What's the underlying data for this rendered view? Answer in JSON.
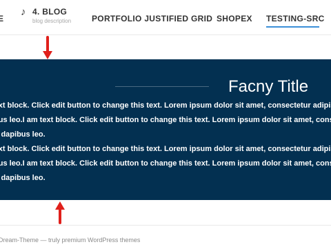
{
  "nav": {
    "cut_item": "E",
    "blog": {
      "icon_glyph": "♪",
      "title": "4. BLOG",
      "description": "blog description"
    },
    "portfolio": "PORTFOLIO JUSTIFIED GRID",
    "shopex": "SHOPEX",
    "testing": "TESTING-SRC",
    "active_item": "TESTING-SRC",
    "accent_color": "#3a8fd8"
  },
  "banner": {
    "title": "Facny Title",
    "background_color": "#033051",
    "paragraph1": [
      "text block. Click edit button to change this text. Lorem ipsum dolor sit amet, consectetur adipis",
      "ibus leo.I am text block. Click edit button to change this text. Lorem ipsum dolor sit amet, conse",
      "ar dapibus leo."
    ],
    "paragraph2": [
      "text block. Click edit button to change this text. Lorem ipsum dolor sit amet, consectetur adipis",
      "ibus leo.I am text block. Click edit button to change this text. Lorem ipsum dolor sit amet, conse",
      "ar dapibus leo."
    ]
  },
  "annotations": {
    "arrow_icon": "red-arrow-icon",
    "arrow_color": "#e0201b"
  },
  "footer": {
    "text": "Dream-Theme — truly premium WordPress themes"
  }
}
